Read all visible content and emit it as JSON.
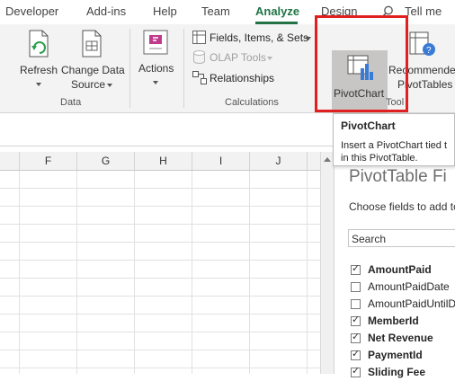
{
  "ribbon_tabs": [
    {
      "label": "Developer",
      "active": false
    },
    {
      "label": "Add-ins",
      "active": false
    },
    {
      "label": "Help",
      "active": false
    },
    {
      "label": "Team",
      "active": false
    },
    {
      "label": "Analyze",
      "active": true
    },
    {
      "label": "Design",
      "active": false
    }
  ],
  "tell_me": "Tell me",
  "ribbon": {
    "refresh": "Refresh",
    "change_data_source_line1": "Change Data",
    "change_data_source_line2": "Source",
    "actions": "Actions",
    "data_group": "Data",
    "fields_items_sets": "Fields, Items, & Sets",
    "olap_tools": "OLAP Tools",
    "relationships": "Relationships",
    "calculations_group": "Calculations",
    "pivotchart": "PivotChart",
    "recommended_line1": "Recommended",
    "recommended_line2": "PivotTables",
    "tools_group": "Tool"
  },
  "tooltip": {
    "title": "PivotChart",
    "line1": "Insert a PivotChart tied t",
    "line2": "in this PivotTable."
  },
  "columns": [
    "F",
    "G",
    "H",
    "I",
    "J"
  ],
  "field_pane": {
    "title": "PivotTable Fi",
    "subtitle": "Choose fields to add to",
    "search_placeholder": "Search",
    "fields": [
      {
        "name": "AmountPaid",
        "checked": true,
        "bold": true
      },
      {
        "name": "AmountPaidDate",
        "checked": false,
        "bold": false
      },
      {
        "name": "AmountPaidUntilD",
        "checked": false,
        "bold": false
      },
      {
        "name": "MemberId",
        "checked": true,
        "bold": true
      },
      {
        "name": "Net Revenue",
        "checked": true,
        "bold": true
      },
      {
        "name": "PaymentId",
        "checked": true,
        "bold": true
      },
      {
        "name": "Sliding Fee",
        "checked": true,
        "bold": true
      }
    ]
  },
  "colors": {
    "accent": "#217346",
    "highlight_box": "#e02020"
  }
}
